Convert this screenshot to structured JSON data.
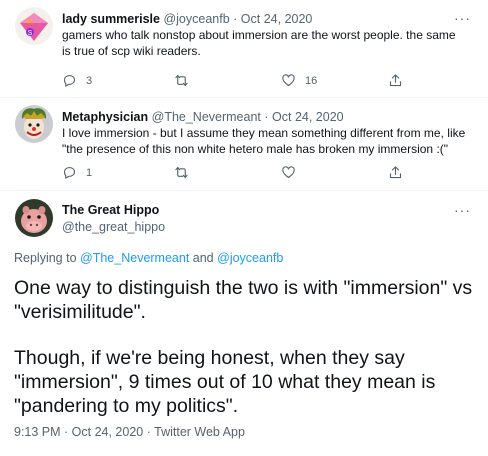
{
  "tweets": [
    {
      "name": "lady summerisle",
      "handle": "@joyceanfb",
      "separator": "·",
      "date": "Oct 24, 2020",
      "text_lines": [
        "gamers who talk nonstop about immersion are the worst people. the same",
        "is true of scp wiki readers."
      ],
      "reply_count": "3",
      "retweet_count": "",
      "like_count": "16",
      "avatar_icon": "pink-diamond-avatar-icon"
    },
    {
      "name": "Metaphysician",
      "handle": "@The_Nevermeant",
      "separator": "·",
      "date": "Oct 24, 2020",
      "text_lines": [
        "I love immersion - but I assume they mean something different from me, like",
        "\"the presence of this non white hetero male has broken my immersion :(\""
      ],
      "reply_count": "1",
      "retweet_count": "",
      "like_count": "",
      "avatar_icon": "clown-face-avatar-icon"
    }
  ],
  "main_tweet": {
    "name": "The Great Hippo",
    "handle": "@the_great_hippo",
    "replying_prefix": "Replying to",
    "replying_user1": "@The_Nevermeant",
    "replying_and": "and",
    "replying_user2": "@joyceanfb",
    "text_lines": [
      "One way to distinguish the two is with \"immersion\" vs",
      "\"verisimilitude\".",
      "Though, if we're being honest, when they say",
      "\"immersion\", 9 times out of 10 what they mean is",
      "\"pandering to my politics\"."
    ],
    "timestamp": "9:13 PM · Oct 24, 2020 · Twitter Web App",
    "avatar_icon": "hippo-avatar-icon"
  },
  "more_glyph": "···",
  "colors": {
    "link": "#1d9bf0",
    "secondary_text": "#536471",
    "thread_line": "#cfd9de",
    "primary_text": "#0f1419"
  }
}
